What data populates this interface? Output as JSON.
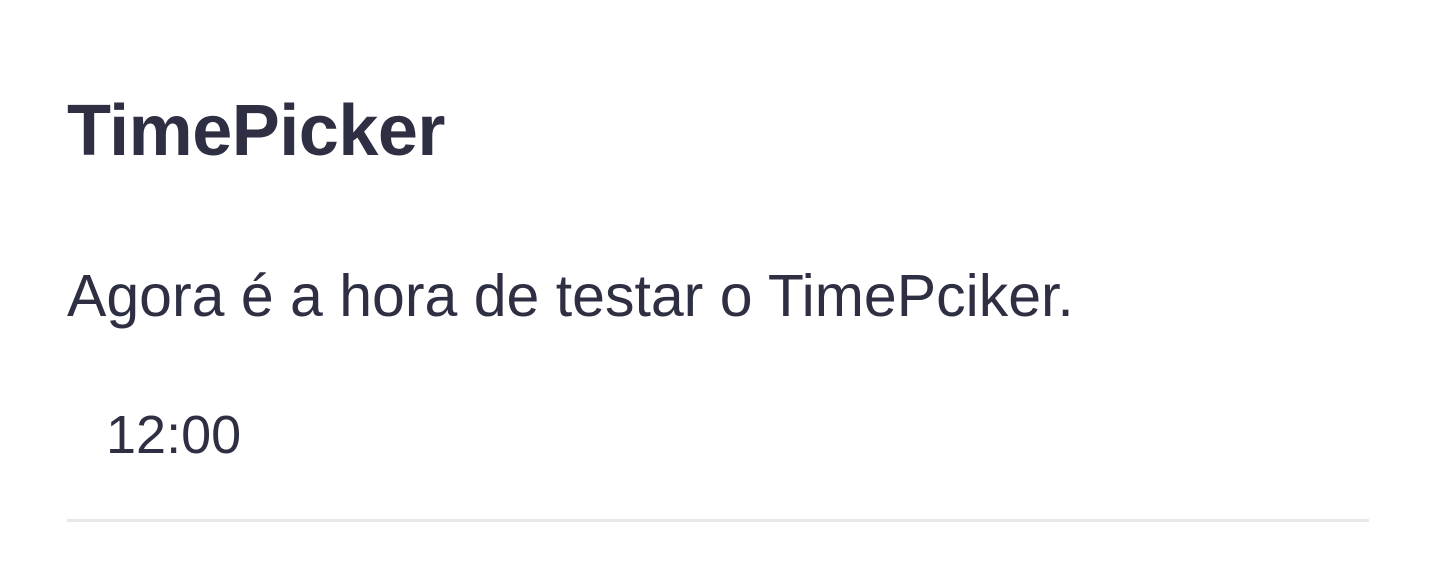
{
  "page": {
    "title": "TimePicker",
    "description": "Agora é a hora de testar o TimePciker."
  },
  "time_picker": {
    "value": "12:00"
  },
  "colors": {
    "text": "#2e2f42",
    "underline": "#e8e8ec",
    "background": "#ffffff"
  }
}
